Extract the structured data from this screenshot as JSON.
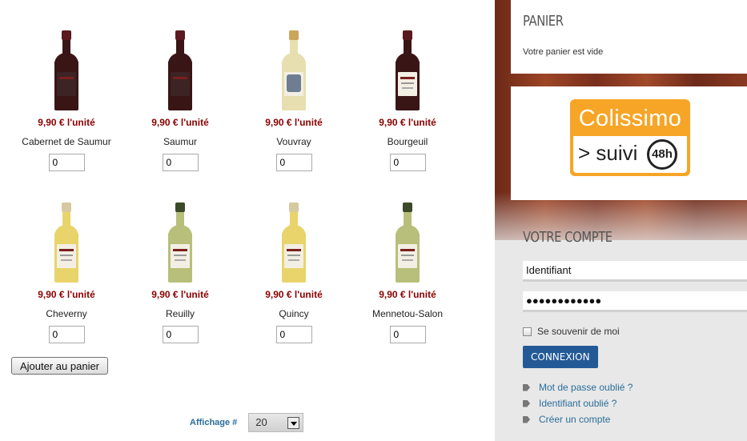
{
  "products": [
    {
      "name": "Cabernet de Saumur",
      "price": "9,90 € l'unité",
      "qty": "0",
      "bottle": "red",
      "label": "dark"
    },
    {
      "name": "Saumur",
      "price": "9,90 € l'unité",
      "qty": "0",
      "bottle": "red",
      "label": "dark"
    },
    {
      "name": "Vouvray",
      "price": "9,90 € l'unité",
      "qty": "0",
      "bottle": "white",
      "label": "swirl"
    },
    {
      "name": "Bourgeuil",
      "price": "9,90 € l'unité",
      "qty": "0",
      "bottle": "red",
      "label": "light"
    },
    {
      "name": "Cheverny",
      "price": "9,90 € l'unité",
      "qty": "0",
      "bottle": "gold",
      "label": "light"
    },
    {
      "name": "Reuilly",
      "price": "9,90 € l'unité",
      "qty": "0",
      "bottle": "green",
      "label": "light"
    },
    {
      "name": "Quincy",
      "price": "9,90 € l'unité",
      "qty": "0",
      "bottle": "gold",
      "label": "light"
    },
    {
      "name": "Mennetou-Salon",
      "price": "9,90 € l'unité",
      "qty": "0",
      "bottle": "green",
      "label": "light"
    }
  ],
  "bottle_colors": {
    "red": {
      "glass": "#3a1516",
      "cap": "#5a1a1f"
    },
    "white": {
      "glass": "#e7dfb0",
      "cap": "#c9a65a"
    },
    "gold": {
      "glass": "#e8d46a",
      "cap": "#d6c9a0"
    },
    "green": {
      "glass": "#b7bf7a",
      "cap": "#3c4a2a"
    }
  },
  "main": {
    "add_to_cart": "Ajouter au panier",
    "affichage_label": "Affichage #",
    "affichage_value": "20"
  },
  "sidebar": {
    "panier_title": "Panier",
    "panier_empty": "Votre panier est vide",
    "colissimo_top": "Colissimo",
    "colissimo_suivi": "> suivi",
    "colissimo_48h": "48h",
    "compte_title": "Votre compte",
    "username_value": "Identifiant",
    "password_value": "●●●●●●●●●●●●",
    "remember_label": "Se souvenir de moi",
    "login_button": "Connexion",
    "links": [
      "Mot de passe oublié ?",
      "Identifiant oublié ?",
      "Créer un compte"
    ]
  },
  "colors": {
    "price": "#8b0000",
    "link": "#2a6d9a",
    "button": "#235a96",
    "colissimo": "#f7a527"
  }
}
